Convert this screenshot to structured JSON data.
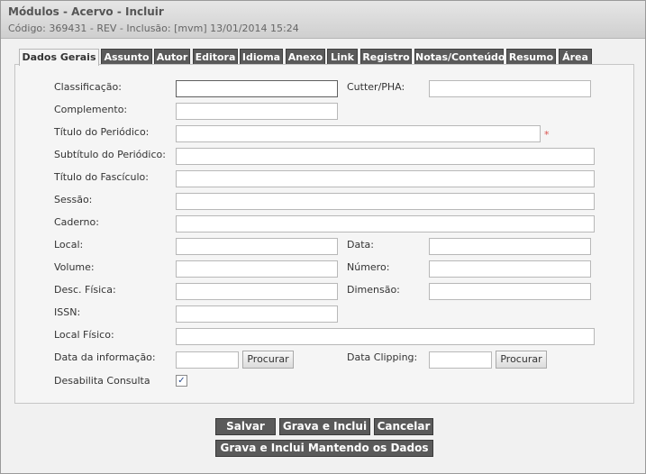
{
  "header": {
    "title": "Módulos - Acervo - Incluir",
    "subtitle": "Código: 369431 - REV - Inclusão: [mvm] 13/01/2014 15:24"
  },
  "tabs": [
    {
      "label": "Dados Gerais",
      "active": true
    },
    {
      "label": "Assunto"
    },
    {
      "label": "Autor"
    },
    {
      "label": "Editora"
    },
    {
      "label": "Idioma"
    },
    {
      "label": "Anexo"
    },
    {
      "label": "Link"
    },
    {
      "label": "Registro"
    },
    {
      "label": "Notas/Conteúdo"
    },
    {
      "label": "Resumo"
    },
    {
      "label": "Área"
    }
  ],
  "form": {
    "classificacao": {
      "label": "Classificação:",
      "value": ""
    },
    "cutter": {
      "label": "Cutter/PHA:",
      "value": ""
    },
    "complemento": {
      "label": "Complemento:",
      "value": ""
    },
    "titulo_periodico": {
      "label": "Título do Periódico:",
      "value": "",
      "required_mark": "*"
    },
    "subtitulo_periodico": {
      "label": "Subtítulo do Periódico:",
      "value": ""
    },
    "titulo_fasciculo": {
      "label": "Título do Fascículo:",
      "value": ""
    },
    "sessao": {
      "label": "Sessão:",
      "value": ""
    },
    "caderno": {
      "label": "Caderno:",
      "value": ""
    },
    "local": {
      "label": "Local:",
      "value": ""
    },
    "data": {
      "label": "Data:",
      "value": ""
    },
    "volume": {
      "label": "Volume:",
      "value": ""
    },
    "numero": {
      "label": "Número:",
      "value": ""
    },
    "desc_fisica": {
      "label": "Desc. Física:",
      "value": ""
    },
    "dimensao": {
      "label": "Dimensão:",
      "value": ""
    },
    "issn": {
      "label": "ISSN:",
      "value": ""
    },
    "local_fisico": {
      "label": "Local Físico:",
      "value": ""
    },
    "data_informacao": {
      "label": "Data da informação:",
      "value": "",
      "button": "Procurar"
    },
    "data_clipping": {
      "label": "Data Clipping:",
      "value": "",
      "button": "Procurar"
    },
    "desabilita_consulta": {
      "label": "Desabilita Consulta",
      "checked": true,
      "check_glyph": "✓"
    }
  },
  "actions": {
    "salvar": "Salvar",
    "grava_inclui": "Grava e Inclui",
    "cancelar": "Cancelar",
    "grava_inclui_mantendo": "Grava e Inclui Mantendo os Dados"
  }
}
